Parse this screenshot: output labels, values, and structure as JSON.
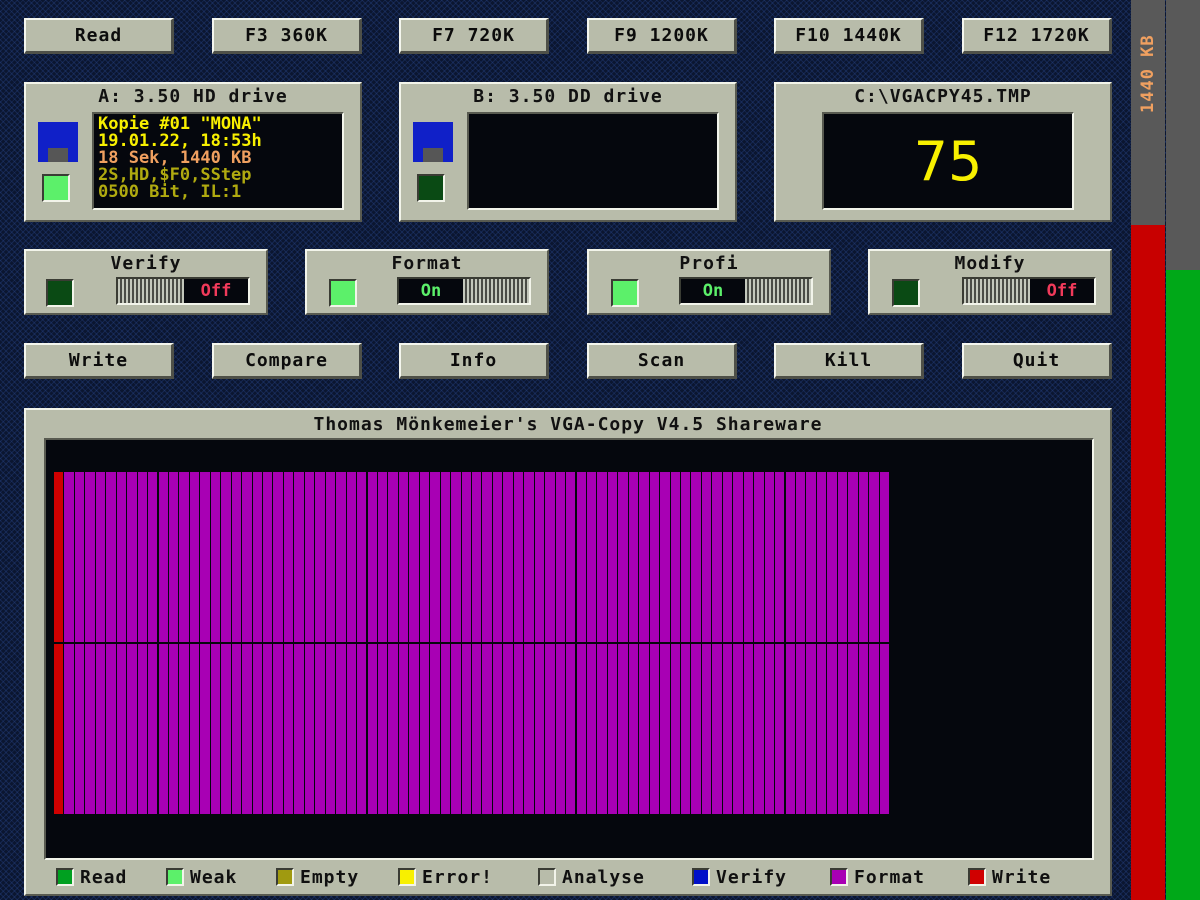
{
  "toolbar": {
    "read": "Read",
    "f3": "F3 360K",
    "f7": "F7 720K",
    "f9": "F9 1200K",
    "f10": "F10 1440K",
    "f12": "F12 1720K"
  },
  "drive_a": {
    "title": "A: 3.50 HD drive",
    "line1": "Kopie #01 \"MONA\"",
    "line2": "19.01.22, 18:53h",
    "line3": "18 Sek, 1440 KB",
    "line4": "2S,HD,$F0,SStep",
    "line5": "0500 Bit, IL:1",
    "led": "on"
  },
  "drive_b": {
    "title": "B: 3.50 DD drive",
    "led": "off"
  },
  "drive_c": {
    "title": "C:\\VGACPY45.TMP",
    "value": "75"
  },
  "options": {
    "verify": {
      "label": "Verify",
      "led": "off",
      "state": "Off"
    },
    "format": {
      "label": "Format",
      "led": "on",
      "state": "On"
    },
    "profi": {
      "label": "Profi",
      "led": "on",
      "state": "On"
    },
    "modify": {
      "label": "Modify",
      "led": "off",
      "state": "Off"
    }
  },
  "actions": {
    "write": "Write",
    "compare": "Compare",
    "info": "Info",
    "scan": "Scan",
    "kill": "Kill",
    "quit": "Quit"
  },
  "main": {
    "title": "Thomas Mönkemeier's VGA-Copy V4.5 Shareware",
    "track_map": {
      "total_tracks": 80,
      "tracks_done": 80,
      "sides": 2,
      "first_track_color": "#d00000",
      "track_color": "#a800b4"
    }
  },
  "legend": {
    "read": "Read",
    "weak": "Weak",
    "empty": "Empty",
    "error": "Error!",
    "analyse": "Analyse",
    "verify": "Verify",
    "format": "Format",
    "write": "Write",
    "colors": {
      "read": "#00a020",
      "weak": "#5cf06a",
      "empty": "#a09a10",
      "error": "#f8f000",
      "analyse": "#b8bcaa",
      "verify": "#0010c8",
      "format": "#a800b4",
      "write": "#d00000"
    }
  },
  "sidebar": {
    "label": "1440 KB",
    "left_fill": 0.75,
    "right_fill": 0.7,
    "left_color": "#c80000",
    "right_color": "#00a818",
    "empty_color": "#595959",
    "label_color": "#f0a060"
  }
}
